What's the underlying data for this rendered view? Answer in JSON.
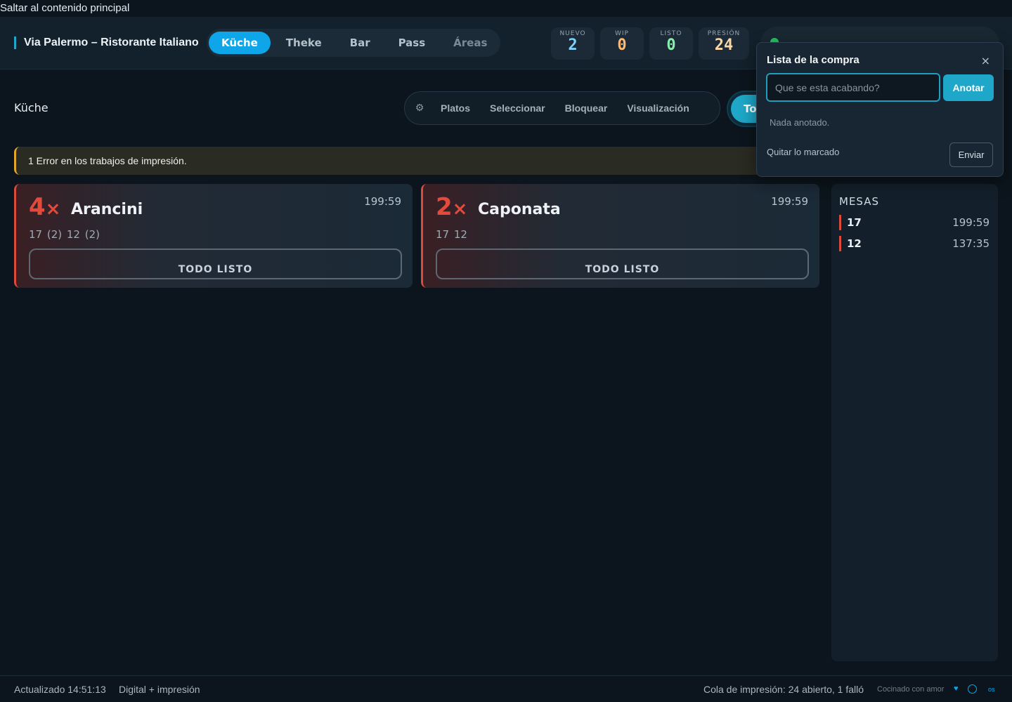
{
  "skip_link": "Saltar al contenido principal",
  "header": {
    "brand": "Via Palermo – Ristorante Italiano",
    "tabs": [
      {
        "label": "Küche"
      },
      {
        "label": "Theke"
      },
      {
        "label": "Bar"
      },
      {
        "label": "Pass"
      },
      {
        "label": "Áreas"
      }
    ],
    "counters": {
      "new": {
        "label": "NUEVO",
        "value": "2"
      },
      "wip": {
        "label": "WIP",
        "value": "0"
      },
      "ready": {
        "label": "LISTO",
        "value": "0"
      },
      "pressure": {
        "label": "PRESIÓN",
        "value": "24"
      }
    }
  },
  "toolbar": {
    "title": "Küche",
    "gear_icon": "⚙",
    "buttons": [
      {
        "label": "Platos"
      },
      {
        "label": "Seleccionar"
      },
      {
        "label": "Bloquear"
      },
      {
        "label": "Visualización"
      }
    ],
    "all_label": "To"
  },
  "banner": {
    "text": "1 Error en los trabajos de impresión."
  },
  "cards": [
    {
      "qty": "4",
      "dish": "Arancini",
      "timer": "199:59",
      "tables": "17 (2)  12 (2)",
      "action": "TODO LISTO"
    },
    {
      "qty": "2",
      "dish": "Caponata",
      "timer": "199:59",
      "tables": "17  12",
      "action": "TODO LISTO"
    }
  ],
  "qty_suffix": "×",
  "sidebar": {
    "title": "MESAS",
    "rows": [
      {
        "table": "17",
        "time": "199:59"
      },
      {
        "table": "12",
        "time": "137:35"
      }
    ]
  },
  "shopping_list": {
    "title": "Lista de la compra",
    "close": "×",
    "placeholder": "Que se esta acabando?",
    "add_label": "Anotar",
    "empty": "Nada anotado.",
    "clear_label": "Quitar lo marcado",
    "send_label": "Enviar"
  },
  "footer": {
    "updated": "Actualizado 14:51:13",
    "mode": "Digital + impresión",
    "queue": "Cola de impresión: 24 abierto, 1 falló",
    "love": "Cocinado con amor",
    "heart": "♥",
    "os": "os"
  },
  "colors": {
    "accent": "#0ea5e9",
    "alert": "#dc4a3b",
    "warning": "#e2a72b"
  }
}
